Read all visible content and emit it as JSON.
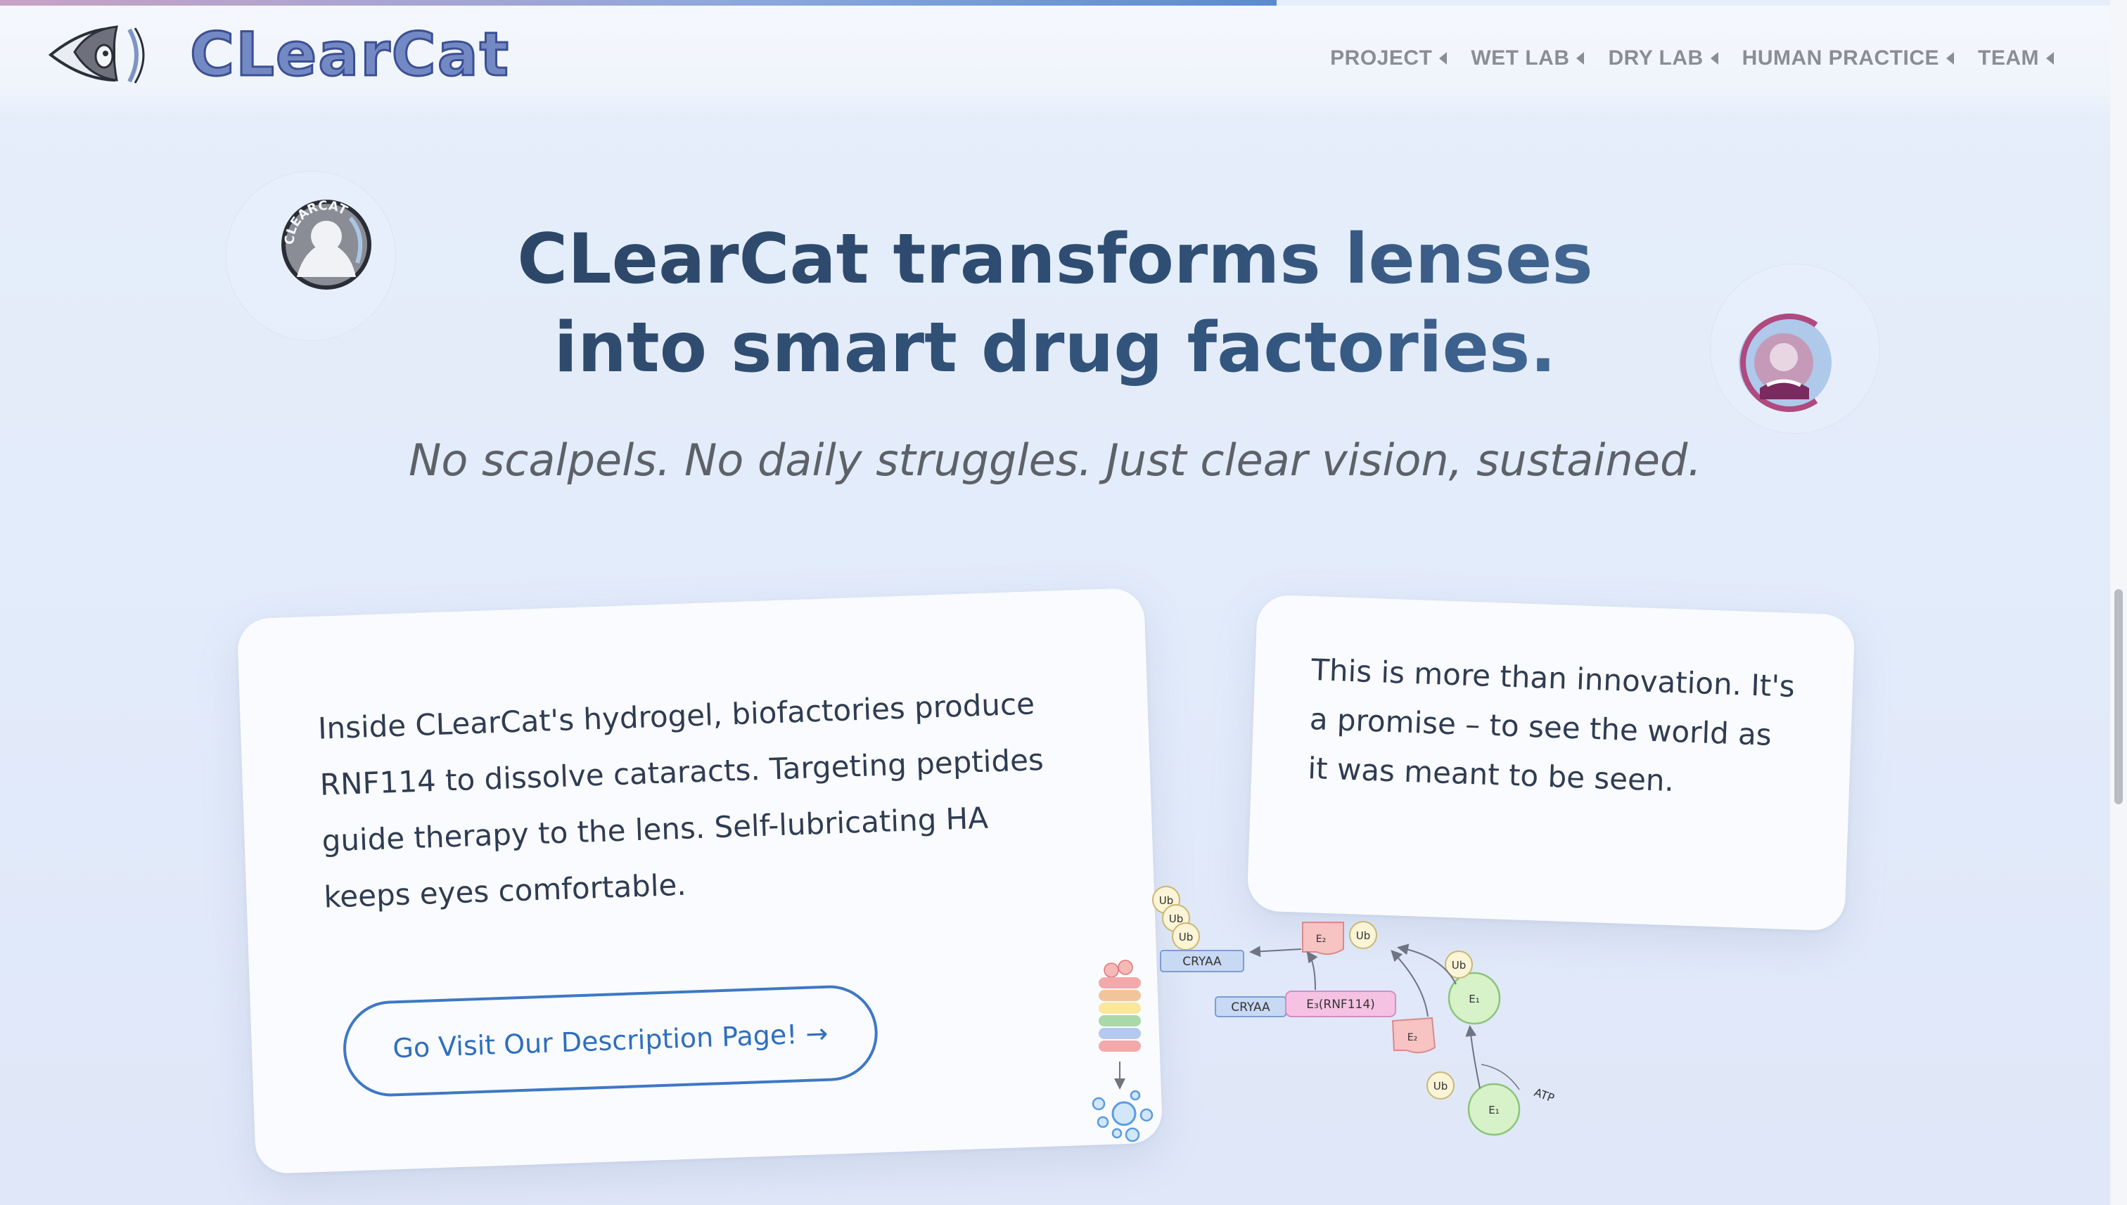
{
  "header": {
    "brand": "CLearCat",
    "nav": [
      {
        "label": "PROJECT"
      },
      {
        "label": "WET LAB"
      },
      {
        "label": "DRY LAB"
      },
      {
        "label": "HUMAN PRACTICE"
      },
      {
        "label": "TEAM"
      }
    ]
  },
  "avatars": {
    "left_badge_text": "CLEARCAT"
  },
  "hero": {
    "headline_line1": "CLearCat transforms lenses",
    "headline_line2": "into smart drug factories.",
    "tagline": "No scalpels. No daily struggles. Just clear vision, sustained."
  },
  "card_left": {
    "text": "Inside CLearCat's hydrogel, biofactories produce RNF114 to dissolve cataracts. Targeting peptides guide therapy to the lens. Self-lubricating HA keeps eyes comfortable.",
    "cta_label": "Go Visit Our Description Page! →"
  },
  "card_right": {
    "text": "This is more than innovation. It's a promise – to see the world as it was meant to be seen."
  },
  "diagram": {
    "ub": "Ub",
    "cryaa": "CRYAA",
    "e3": "E₃(RNF114)",
    "e2": "E₂",
    "e1": "E₁",
    "atp": "ATP"
  },
  "colors": {
    "brand_blue": "#7289c4",
    "heading_dark": "#2b415e",
    "accent_blue": "#3e78c5",
    "nav_gray": "#8a8e94"
  }
}
